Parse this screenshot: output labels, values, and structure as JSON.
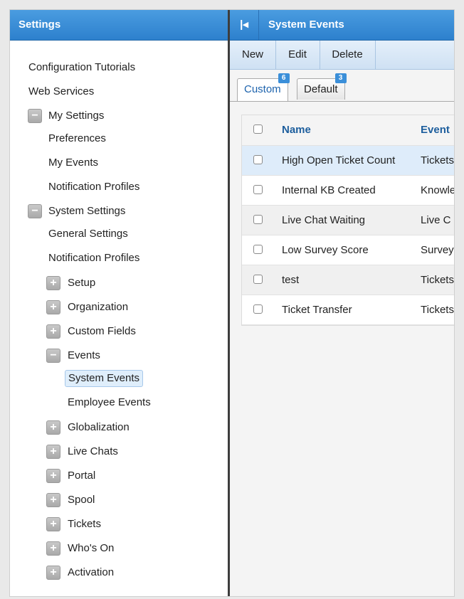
{
  "left_panel": {
    "title": "Settings",
    "items": [
      {
        "label": "Configuration Tutorials"
      },
      {
        "label": "Web Services"
      },
      {
        "label": "My Settings",
        "toggle": "−"
      },
      {
        "label": "Preferences"
      },
      {
        "label": "My Events"
      },
      {
        "label": "Notification Profiles"
      },
      {
        "label": "System Settings",
        "toggle": "−"
      },
      {
        "label": "General Settings"
      },
      {
        "label": "Notification Profiles"
      },
      {
        "label": "Setup",
        "toggle": "+"
      },
      {
        "label": "Organization",
        "toggle": "+"
      },
      {
        "label": "Custom Fields",
        "toggle": "+"
      },
      {
        "label": "Events",
        "toggle": "−"
      },
      {
        "label": "System Events",
        "selected": true
      },
      {
        "label": "Employee Events"
      },
      {
        "label": "Globalization",
        "toggle": "+"
      },
      {
        "label": "Live Chats",
        "toggle": "+"
      },
      {
        "label": "Portal",
        "toggle": "+"
      },
      {
        "label": "Spool",
        "toggle": "+"
      },
      {
        "label": "Tickets",
        "toggle": "+"
      },
      {
        "label": "Who's On",
        "toggle": "+"
      },
      {
        "label": "Activation",
        "toggle": "+"
      }
    ]
  },
  "right_panel": {
    "collapse_glyph": "|◂",
    "title": "System Events",
    "toolbar": {
      "new_label": "New",
      "edit_label": "Edit",
      "delete_label": "Delete"
    },
    "tabs": [
      {
        "label": "Custom",
        "count": "6",
        "active": true
      },
      {
        "label": "Default",
        "count": "3",
        "active": false
      }
    ],
    "table": {
      "columns": [
        "Name",
        "Event"
      ],
      "rows": [
        {
          "name": "High Open Ticket Count",
          "event": "Tickets"
        },
        {
          "name": "Internal KB Created",
          "event": "Knowle"
        },
        {
          "name": "Live Chat Waiting",
          "event": "Live C"
        },
        {
          "name": "Low Survey Score",
          "event": "Survey"
        },
        {
          "name": "test",
          "event": "Tickets"
        },
        {
          "name": "Ticket Transfer",
          "event": "Tickets"
        }
      ]
    }
  },
  "colors": {
    "header_blue": "#2d80cd",
    "toolbar_blue": "#cfe1f3",
    "selected_row": "#deecfa"
  }
}
